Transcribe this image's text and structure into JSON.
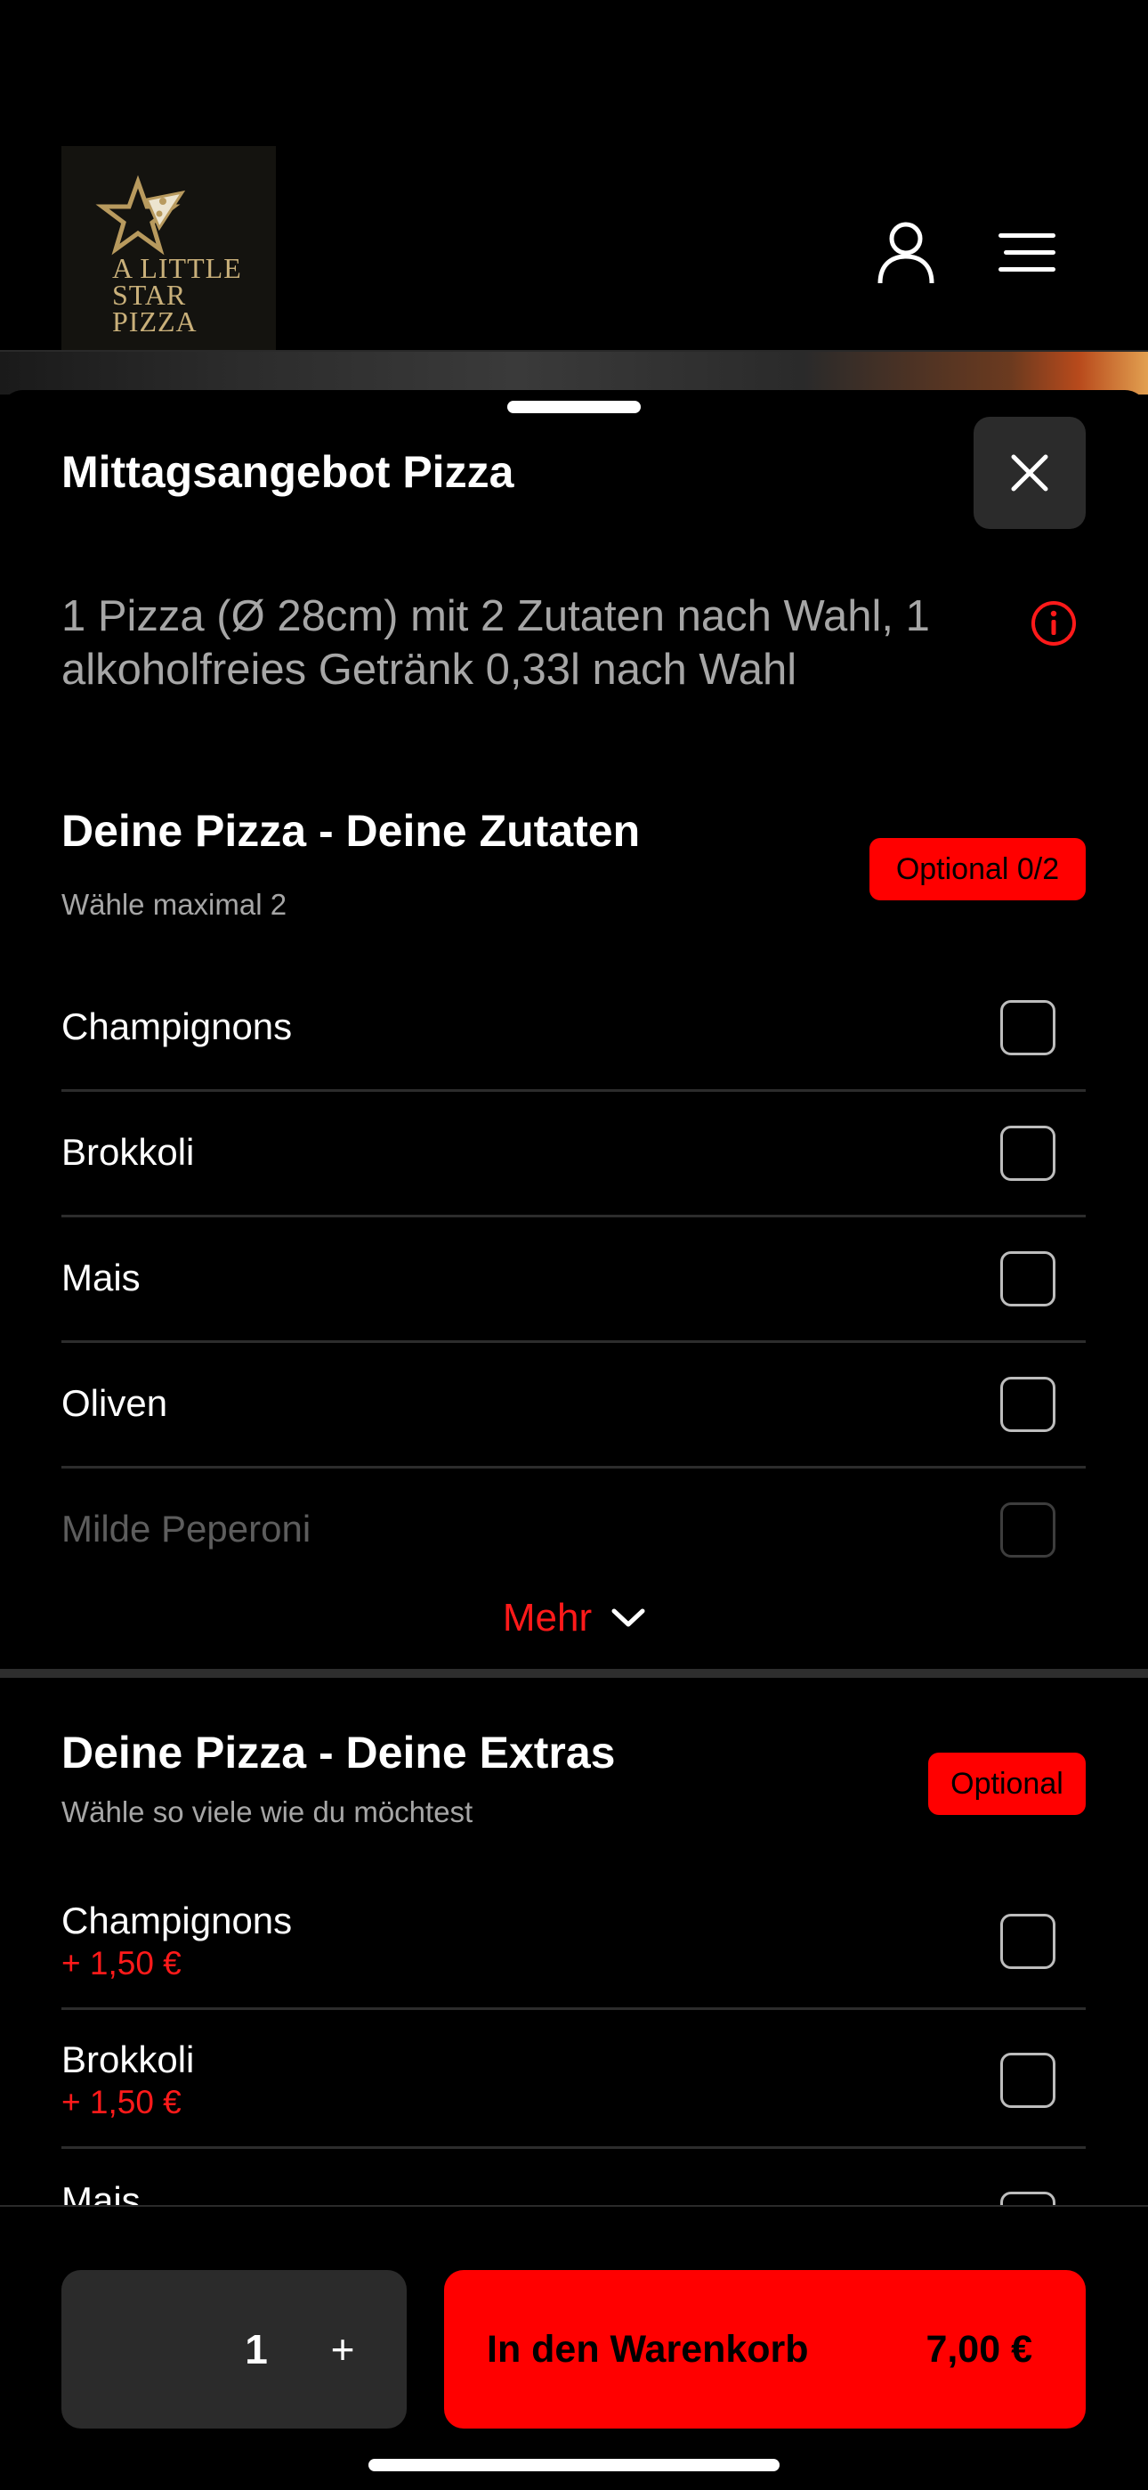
{
  "brand": {
    "logo_lines": [
      "A LITTLE",
      "STAR",
      "PIZZA"
    ],
    "icons": {
      "logo": "star-pizza-logo-icon",
      "user": "user-icon",
      "menu": "hamburger-menu-icon"
    },
    "colors": {
      "logo_gold": "#c9b07a",
      "accent": "#ff0000"
    }
  },
  "modal": {
    "title": "Mittagsangebot Pizza",
    "description": "1 Pizza (Ø 28cm) mit 2 Zutaten nach Wahl, 1 alkoholfreies Getränk 0,33l nach Wahl",
    "icons": {
      "close": "close-icon",
      "info": "info-icon"
    }
  },
  "section_toppings": {
    "title": "Deine Pizza - Deine Zutaten",
    "subtitle": "Wähle maximal 2",
    "badge": "Optional 0/2",
    "items": [
      {
        "label": "Champignons",
        "checked": false
      },
      {
        "label": "Brokkoli",
        "checked": false
      },
      {
        "label": "Mais",
        "checked": false
      },
      {
        "label": "Oliven",
        "checked": false
      },
      {
        "label": "Milde Peperoni",
        "checked": false
      }
    ],
    "more_label": "Mehr"
  },
  "section_extras": {
    "title": "Deine Pizza - Deine Extras",
    "subtitle": "Wähle so viele wie du möchtest",
    "badge": "Optional",
    "items": [
      {
        "label": "Champignons",
        "price": "+ 1,50 €",
        "checked": false
      },
      {
        "label": "Brokkoli",
        "price": "+ 1,50 €",
        "checked": false
      },
      {
        "label": "Mais",
        "checked": false
      }
    ]
  },
  "footer": {
    "quantity": "1",
    "plus_label": "+",
    "cart_label": "In den Warenkorb",
    "cart_price": "7,00 €"
  }
}
